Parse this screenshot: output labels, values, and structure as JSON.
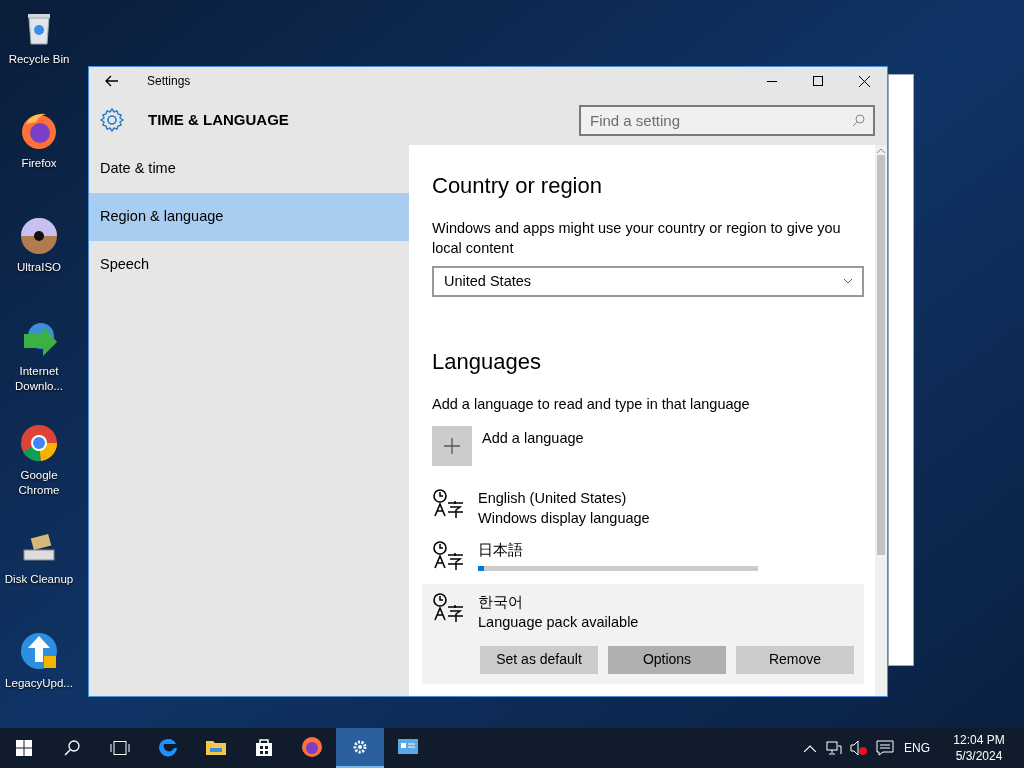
{
  "desktop_icons": [
    {
      "label": "Recycle Bin",
      "kind": "bin"
    },
    {
      "label": "Firefox",
      "kind": "firefox"
    },
    {
      "label": "UltraISO",
      "kind": "disc"
    },
    {
      "label": "Internet Downlo...",
      "kind": "idm"
    },
    {
      "label": "Google Chrome",
      "kind": "chrome"
    },
    {
      "label": "Disk Cleanup",
      "kind": "cleanup"
    },
    {
      "label": "LegacyUpd...",
      "kind": "update"
    }
  ],
  "window": {
    "title": "Settings",
    "heading": "TIME & LANGUAGE",
    "search": {
      "placeholder": "Find a setting"
    }
  },
  "sidebar": {
    "items": [
      {
        "label": "Date & time",
        "selected": false
      },
      {
        "label": "Region & language",
        "selected": true
      },
      {
        "label": "Speech",
        "selected": false
      }
    ]
  },
  "country": {
    "title": "Country or region",
    "description": "Windows and apps might use your country or region to give you local content",
    "value": "United States"
  },
  "languages": {
    "title": "Languages",
    "description": "Add a language to read and type in that language",
    "add_label": "Add a language",
    "items": [
      {
        "name": "English (United States)",
        "status": "Windows display language",
        "selected": false
      },
      {
        "name": "日本語",
        "level": 0.02,
        "selected": false
      },
      {
        "name": "한국어",
        "status": "Language pack available",
        "selected": true,
        "buttons": [
          "Set as default",
          "Options",
          "Remove"
        ]
      }
    ]
  },
  "taskbar": {
    "apps": [
      {
        "kind": "edge",
        "selected": false
      },
      {
        "kind": "folder",
        "selected": false
      },
      {
        "kind": "store",
        "selected": false
      },
      {
        "kind": "firefox",
        "selected": false
      },
      {
        "kind": "settings",
        "selected": true
      },
      {
        "kind": "panel",
        "selected": false
      }
    ],
    "language": "ENG",
    "time": "12:04 PM",
    "date": "5/3/2024"
  }
}
